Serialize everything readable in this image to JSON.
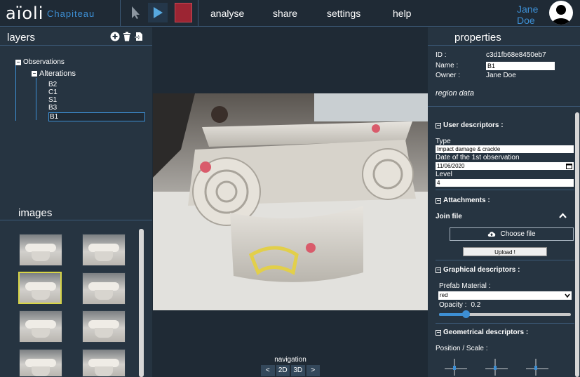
{
  "app": {
    "logo": "aïoli",
    "project": "Chapiteau"
  },
  "menu": [
    "analyse",
    "share",
    "settings",
    "help"
  ],
  "user": {
    "first": "Jane",
    "last": "Doe"
  },
  "layers": {
    "title": "layers",
    "root": "Observations",
    "child": "Alterations",
    "items": [
      "B2",
      "C1",
      "S1",
      "B3",
      "B1"
    ],
    "selected": "B1"
  },
  "images": {
    "title": "images",
    "selected_index": 2,
    "count": 8
  },
  "navigation": {
    "title": "navigation",
    "prev": "<",
    "mode_2d": "2D",
    "mode_3d": "3D",
    "next": ">"
  },
  "properties": {
    "title": "properties",
    "id_label": "ID :",
    "id_value": "c3d1fb68e8450eb7",
    "name_label": "Name :",
    "name_value": "B1",
    "owner_label": "Owner :",
    "owner_value": "Jane Doe",
    "region_data": "region data",
    "user_descriptors": "User descriptors :",
    "type_label": "Type",
    "type_value": "Impact damage & crackle",
    "date_label": "Date of the 1st observation",
    "date_value": "11/06/2020",
    "level_label": "Level",
    "level_value": "4",
    "attachments": "Attachments :",
    "join_file": "Join file",
    "choose_file": "Choose file",
    "upload": "Upload !",
    "graphical_descriptors": "Graphical descriptors :",
    "prefab_label": "Prefab Material :",
    "prefab_value": "red",
    "opacity_label": "Opacity :",
    "opacity_value": "0.2",
    "geometrical_descriptors": "Geometrical descriptors :",
    "position_scale": "Position / Scale :"
  },
  "colors": {
    "accent": "#3d8fd4",
    "record": "#9c2533",
    "background": "#1f2a35",
    "panel": "#263441",
    "selected_thumb": "#d7d447"
  }
}
